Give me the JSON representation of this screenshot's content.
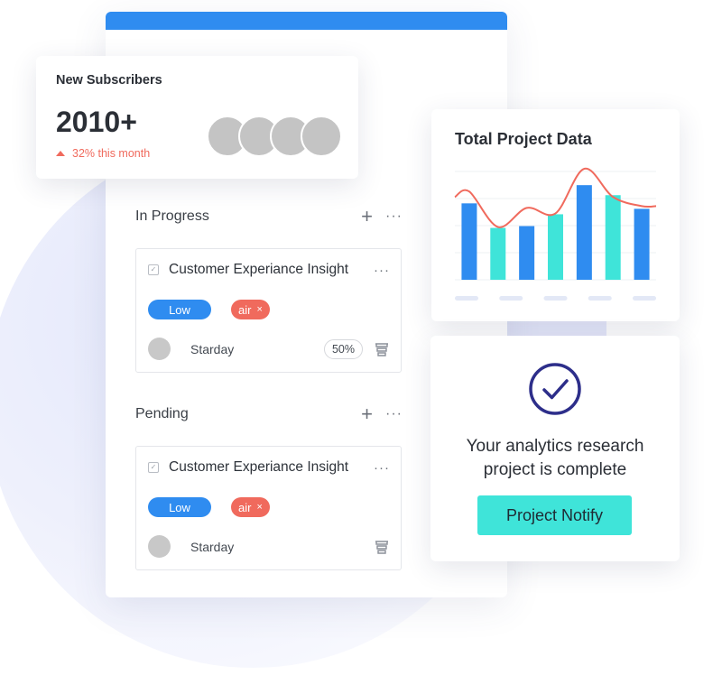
{
  "subscribers": {
    "title": "New Subscribers",
    "count": "2010+",
    "trend": "32% this month",
    "avatar_count": 4
  },
  "board": {
    "sections": [
      {
        "title": "In Progress",
        "task": {
          "title": "Customer Experiance Insight",
          "priority": "Low",
          "tag": "air",
          "assignee": "Starday",
          "progress": "50%"
        }
      },
      {
        "title": "Pending",
        "task": {
          "title": "Customer Experiance Insight",
          "priority": "Low",
          "tag": "air",
          "assignee": "Starday"
        }
      }
    ]
  },
  "chart_data": {
    "type": "bar",
    "title": "Total Project Data",
    "categories": [
      "",
      "",
      "",
      "",
      "",
      "",
      "",
      ""
    ],
    "series": [
      {
        "values": [
          84,
          57,
          59,
          72,
          104,
          93,
          78,
          0
        ],
        "colors": [
          "#2f8cf0",
          "#3fe4d9",
          "#2f8cf0",
          "#3fe4d9",
          "#2f8cf0",
          "#3fe4d9",
          "#2f8cf0"
        ]
      },
      {
        "type": "line",
        "values": [
          97,
          58,
          79,
          73,
          122,
          91,
          81
        ]
      }
    ],
    "ylim": [
      0,
      125
    ],
    "grid": true,
    "colors": {
      "bar_blue": "#2f8cf0",
      "bar_teal": "#3fe4d9",
      "line": "#f06a5d"
    }
  },
  "notify": {
    "message_line1": "Your analytics research",
    "message_line2": "project is complete",
    "button_label": "Project Notify"
  },
  "icons": {
    "add": "+",
    "more": "···",
    "remove": "×",
    "check": "✓"
  }
}
